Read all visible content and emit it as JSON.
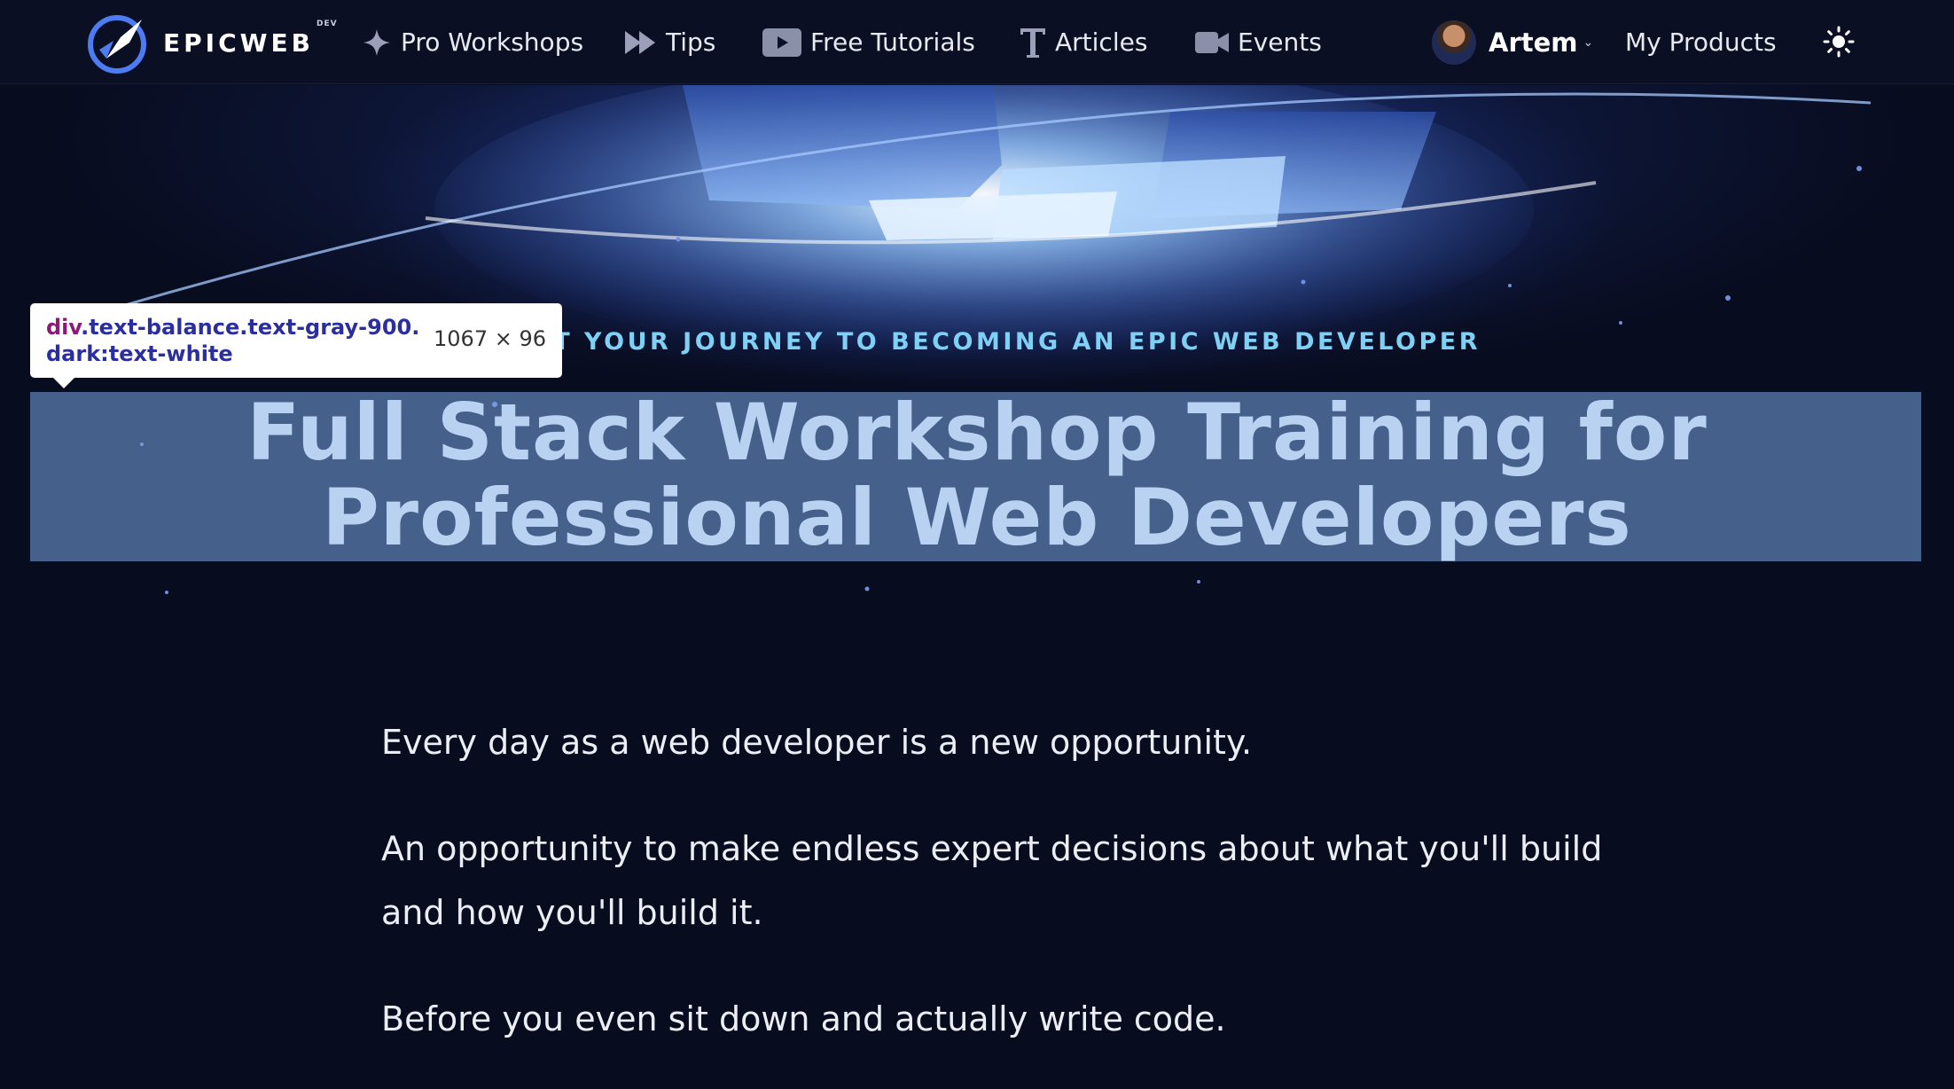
{
  "nav": {
    "logo_text": "EPICWEB",
    "logo_sup": "DEV",
    "items": [
      {
        "label": "Pro Workshops",
        "icon": "sparkle-icon"
      },
      {
        "label": "Tips",
        "icon": "fast-forward-icon"
      },
      {
        "label": "Free Tutorials",
        "icon": "play-icon"
      },
      {
        "label": "Articles",
        "icon": "text-t-icon"
      },
      {
        "label": "Events",
        "icon": "video-camera-icon"
      }
    ],
    "user_name": "Artem",
    "my_products": "My Products",
    "theme_icon": "sun-icon"
  },
  "hero": {
    "eyebrow": "START YOUR JOURNEY TO BECOMING AN EPIC WEB DEVELOPER",
    "headline_line1": "Full Stack Workshop Training for",
    "headline_line2": "Professional Web Developers"
  },
  "devtools_tooltip": {
    "tag": "div",
    "selector_line1": ".text-balance.text-gray-900.",
    "selector_line2": "dark:text-white",
    "size": "1067 × 96"
  },
  "content": {
    "p1": "Every day as a web developer is a new opportunity.",
    "p2_line1": "An opportunity to make endless expert decisions about what you'll build",
    "p2_line2": "and how you'll build it.",
    "p3": "Before you even sit down and actually write code."
  },
  "colors": {
    "background": "#080c1f",
    "eyebrow": "#7fd0f5",
    "highlight": "#78a5e1"
  }
}
